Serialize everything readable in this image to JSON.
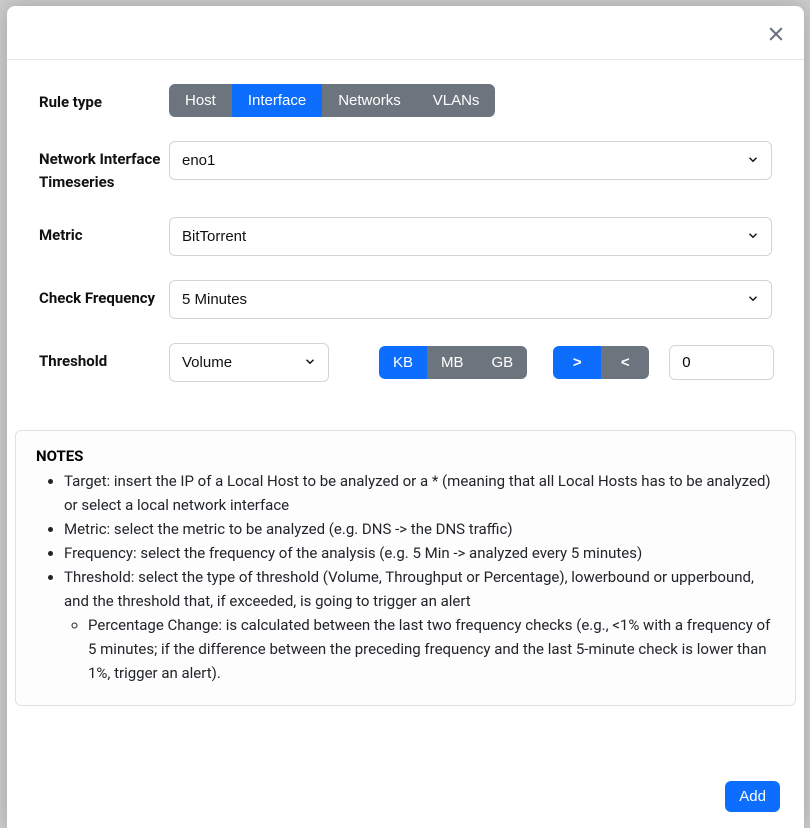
{
  "ruleType": {
    "label": "Rule type",
    "options": [
      "Host",
      "Interface",
      "Networks",
      "VLANs"
    ],
    "activeIndex": 1
  },
  "networkInterface": {
    "label": "Network Interface Timeseries",
    "value": "eno1"
  },
  "metric": {
    "label": "Metric",
    "value": "BitTorrent"
  },
  "checkFrequency": {
    "label": "Check Frequency",
    "value": "5 Minutes"
  },
  "threshold": {
    "label": "Threshold",
    "typeValue": "Volume",
    "units": [
      "KB",
      "MB",
      "GB"
    ],
    "unitActiveIndex": 0,
    "comparators": [
      ">",
      "<"
    ],
    "comparatorActiveIndex": 0,
    "value": "0"
  },
  "notes": {
    "title": "NOTES",
    "items": [
      "Target: insert the IP of a Local Host to be analyzed or a * (meaning that all Local Hosts has to be analyzed) or select a local network interface",
      "Metric: select the metric to be analyzed (e.g. DNS -> the DNS traffic)",
      "Frequency: select the frequency of the analysis (e.g. 5 Min -> analyzed every 5 minutes)",
      "Threshold: select the type of threshold (Volume, Throughput or Percentage), lowerbound or upperbound, and the threshold that, if exceeded, is going to trigger an alert"
    ],
    "subItem": "Percentage Change: is calculated between the last two frequency checks (e.g., <1% with a frequency of 5 minutes; if the difference between the preceding frequency and the last 5-minute check is lower than 1%, trigger an alert)."
  },
  "addLabel": "Add"
}
